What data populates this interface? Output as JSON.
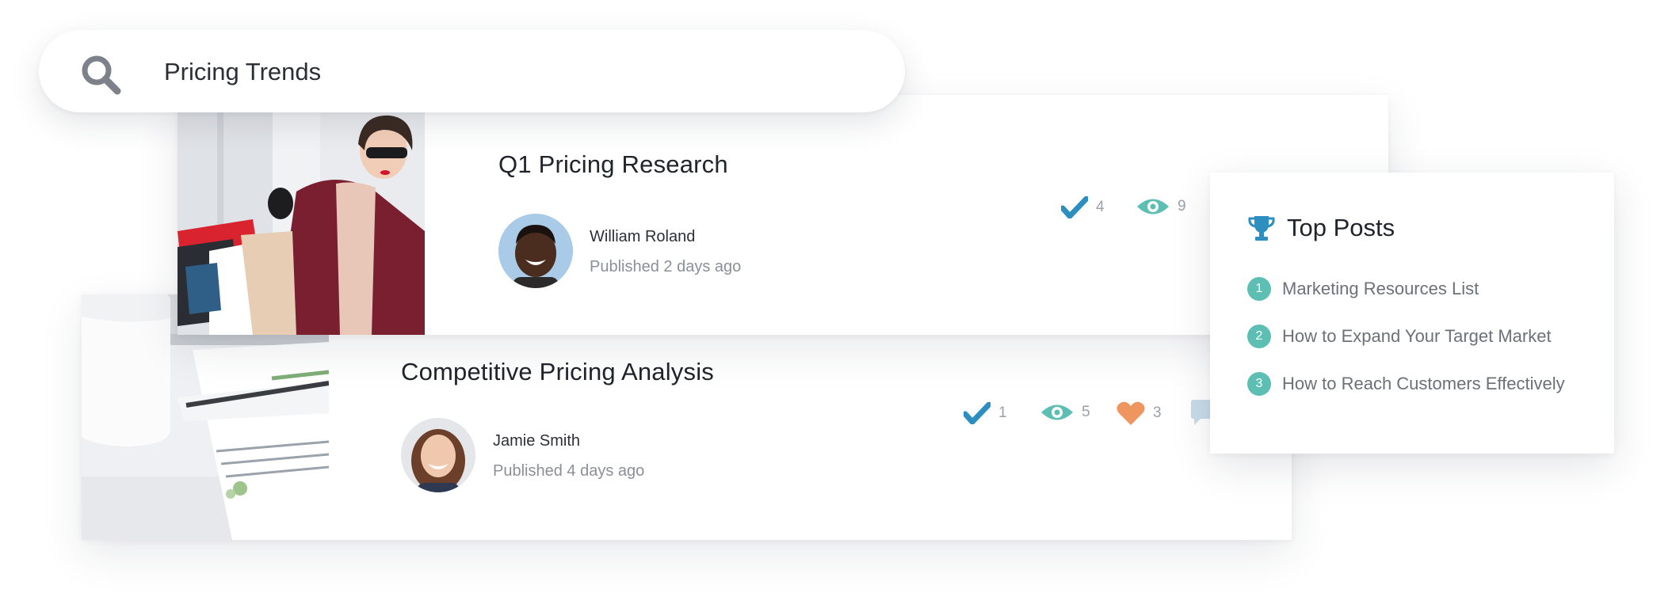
{
  "search": {
    "query": "Pricing Trends",
    "icon": "search-icon"
  },
  "posts": [
    {
      "title": "Q1 Pricing Research",
      "author": "William Roland",
      "published": "Published 2 days ago",
      "stats": {
        "checks": "4",
        "views": "9"
      }
    },
    {
      "title": "Competitive Pricing Analysis",
      "author": "Jamie Smith",
      "published": "Published 4 days ago",
      "stats": {
        "checks": "1",
        "views": "5",
        "likes": "3"
      }
    }
  ],
  "top_posts": {
    "title": "Top Posts",
    "items": [
      {
        "rank": "1",
        "label": "Marketing Resources List"
      },
      {
        "rank": "2",
        "label": "How to Expand Your Target Market"
      },
      {
        "rank": "3",
        "label": "How to Reach Customers Effectively"
      }
    ]
  },
  "colors": {
    "check": "#2c8fc0",
    "eye": "#5dbfb3",
    "heart": "#ee9560",
    "comment": "#c7dbe9",
    "badge": "#5dbfb3",
    "trophy": "#2c8fc0"
  }
}
